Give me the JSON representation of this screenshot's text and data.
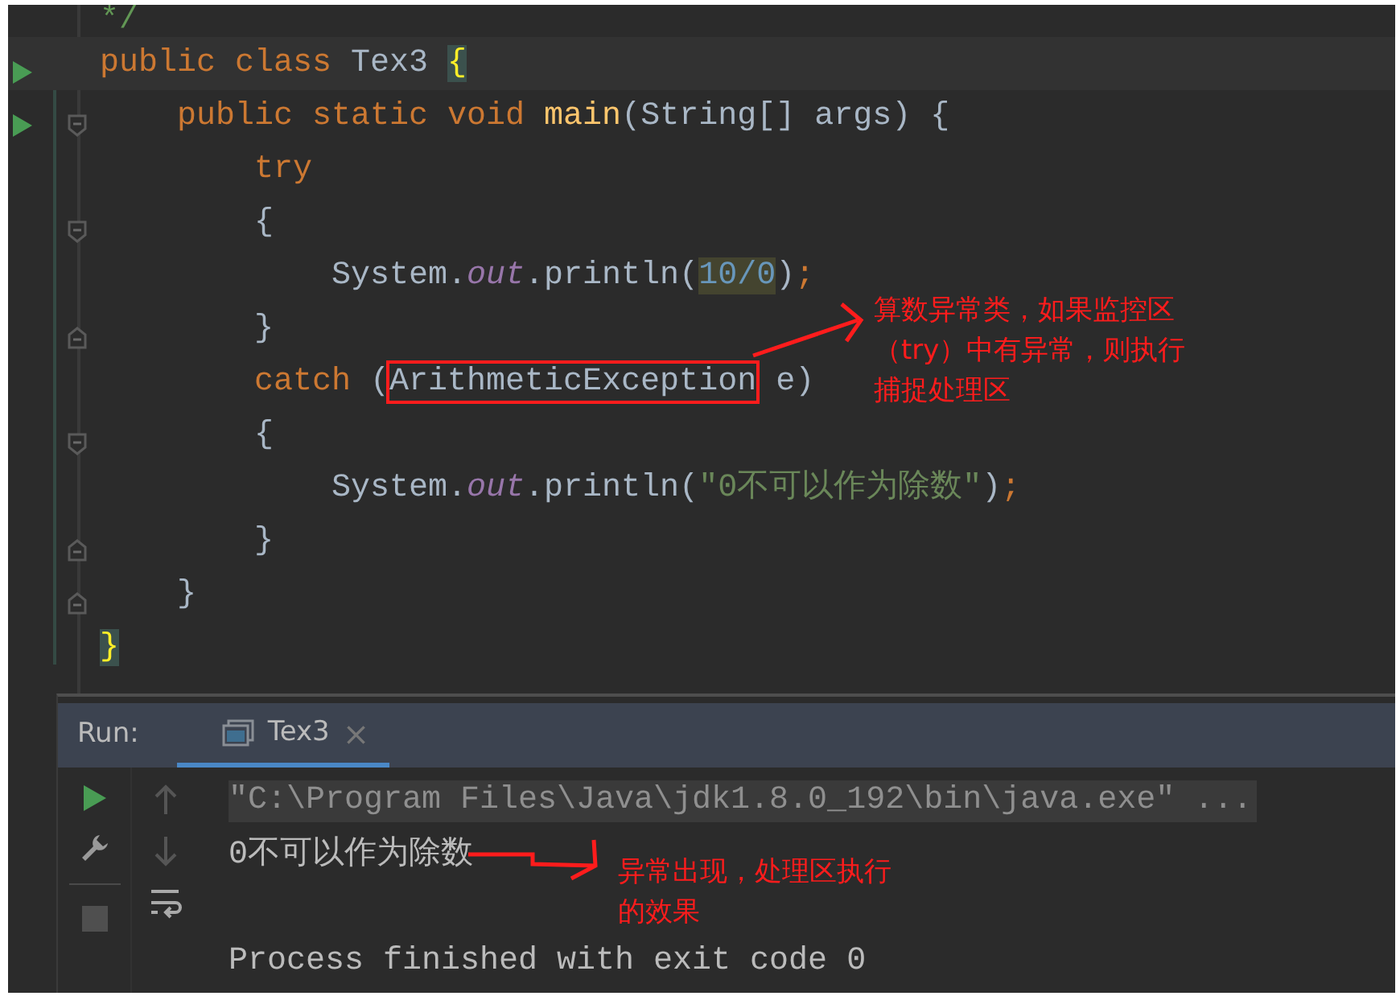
{
  "editor": {
    "lines": [
      {
        "tokens": [
          {
            "text": "*/",
            "kind": "comment"
          }
        ]
      },
      {
        "run": true,
        "current": true,
        "tokens": [
          {
            "text": "public class ",
            "kind": "keyword"
          },
          {
            "text": "Tex3 ",
            "kind": "plain"
          },
          {
            "text": "{",
            "kind": "brace-match"
          }
        ],
        "children": [
          {
            "run": true,
            "fold_start": true,
            "tokens": [
              {
                "text": "public static void ",
                "kind": "keyword"
              },
              {
                "text": "main",
                "kind": "method"
              },
              {
                "text": "(String[] args) {",
                "kind": "plain"
              }
            ],
            "children": [
              {
                "tokens": [
                  {
                    "text": "try",
                    "kind": "keyword"
                  }
                ]
              },
              {
                "fold_start": true,
                "tokens": [
                  {
                    "text": "{",
                    "kind": "plain"
                  }
                ],
                "children": [
                  {
                    "tokens": [
                      {
                        "text": "System.",
                        "kind": "plain"
                      },
                      {
                        "text": "out",
                        "kind": "field"
                      },
                      {
                        "text": ".println(",
                        "kind": "plain"
                      },
                      {
                        "text": "10/0",
                        "kind": "number-hl"
                      },
                      {
                        "text": ")",
                        "kind": "plain"
                      },
                      {
                        "text": ";",
                        "kind": "keyword"
                      }
                    ]
                  }
                ]
              },
              {
                "fold_end": true,
                "tokens": [
                  {
                    "text": "}",
                    "kind": "plain"
                  }
                ]
              },
              {
                "tokens": [
                  {
                    "text": "catch ",
                    "kind": "keyword"
                  },
                  {
                    "text": "(",
                    "kind": "plain"
                  },
                  {
                    "text": "ArithmeticException",
                    "kind": "boxed"
                  },
                  {
                    "text": " e)",
                    "kind": "plain"
                  }
                ]
              },
              {
                "fold_start": true,
                "tokens": [
                  {
                    "text": "{",
                    "kind": "plain"
                  }
                ],
                "children": [
                  {
                    "tokens": [
                      {
                        "text": "System.",
                        "kind": "plain"
                      },
                      {
                        "text": "out",
                        "kind": "field"
                      },
                      {
                        "text": ".println(",
                        "kind": "plain"
                      },
                      {
                        "text": "\"0不可以作为除数\"",
                        "kind": "string"
                      },
                      {
                        "text": ")",
                        "kind": "plain"
                      },
                      {
                        "text": ";",
                        "kind": "keyword"
                      }
                    ]
                  }
                ]
              },
              {
                "fold_end": true,
                "tokens": [
                  {
                    "text": "}",
                    "kind": "plain"
                  }
                ]
              }
            ]
          },
          {
            "fold_end": true,
            "tokens": [
              {
                "text": "}",
                "kind": "plain"
              }
            ]
          }
        ]
      },
      {
        "tokens": [
          {
            "text": "}",
            "kind": "brace-match"
          }
        ]
      }
    ]
  },
  "annotations": [
    {
      "lines": [
        "算数异常类，如果监控区",
        "（try）中有异常，则执行",
        "捕捉处理区"
      ]
    },
    {
      "lines": [
        "异常出现，处理区执行",
        "的效果"
      ]
    }
  ],
  "run_panel": {
    "label": "Run:",
    "tabs": [
      {
        "label": "Tex3",
        "close": "×",
        "selected": true
      }
    ],
    "console": [
      {
        "text": "\"C:\\Program Files\\Java\\jdk1.8.0_192\\bin\\java.exe\" ...",
        "kind": "command"
      },
      {
        "text": "0不可以作为除数",
        "kind": "output"
      },
      {
        "text": "Process finished with exit code 0",
        "kind": "exit"
      }
    ]
  }
}
